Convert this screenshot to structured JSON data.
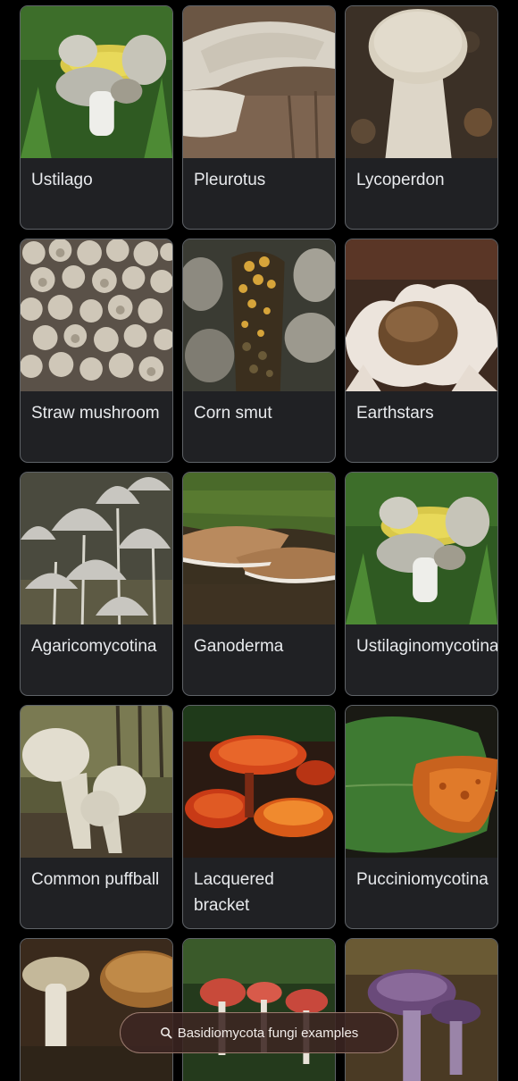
{
  "cards": [
    {
      "label": "Ustilago",
      "image": "corn-smut-ear-photo"
    },
    {
      "label": "Pleurotus",
      "image": "oyster-mushroom-on-stump-photo"
    },
    {
      "label": "Lycoperdon",
      "image": "puffball-photo"
    },
    {
      "label": "Straw mushroom",
      "image": "straw-mushroom-pile-photo"
    },
    {
      "label": "Corn smut",
      "image": "corn-smut-closeup-photo"
    },
    {
      "label": "Earthstars",
      "image": "earthstar-photo"
    },
    {
      "label": "Agaricomycotina",
      "image": "inkcap-cluster-photo"
    },
    {
      "label": "Ganoderma",
      "image": "bracket-fungus-moss-photo"
    },
    {
      "label": "Ustilaginomycotina",
      "image": "corn-smut-ear-photo"
    },
    {
      "label": "Common puffball",
      "image": "white-puffballs-forest-photo"
    },
    {
      "label": "Lacquered bracket",
      "image": "red-reishi-photo"
    },
    {
      "label": "Pucciniomycotina",
      "image": "rust-on-leaf-photo"
    }
  ],
  "partial_cards": [
    {
      "image": "brown-cap-mushrooms-photo"
    },
    {
      "image": "red-cap-mushrooms-photo"
    },
    {
      "image": "purple-cap-mushroom-photo"
    }
  ],
  "search_pill": {
    "text": "Basidiomycota fungi examples",
    "icon": "search-icon"
  }
}
